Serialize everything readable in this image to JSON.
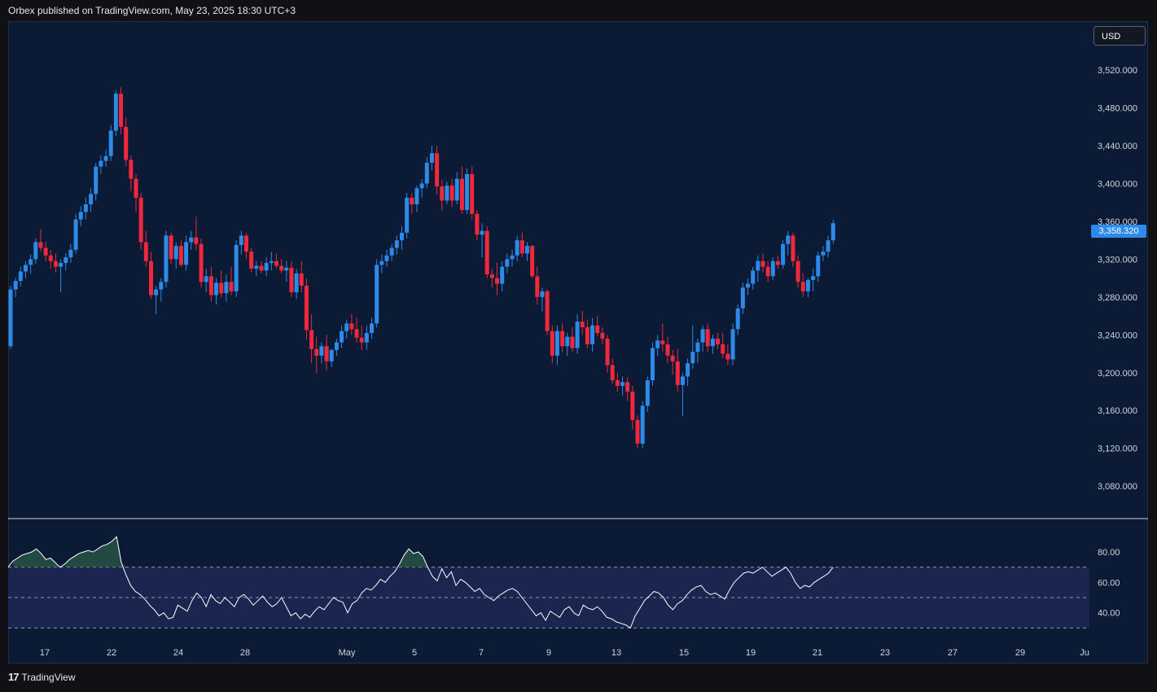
{
  "header": {
    "published": "Orbex published on TradingView.com, May 23, 2025 18:30 UTC+3"
  },
  "currency": "USD",
  "last_price": "3,358.320",
  "footer": {
    "brand": "TradingView",
    "logo": "tradingview-logo-icon"
  },
  "colors": {
    "up": "#2c8ae8",
    "down": "#f0283c",
    "background": "#0b1a35",
    "rsi_band": "#1a2550",
    "rsi_line": "#ffffff"
  },
  "price_axis": {
    "labels": [
      "3,520.000",
      "3,480.000",
      "3,440.000",
      "3,400.000",
      "3,360.000",
      "3,320.000",
      "3,280.000",
      "3,240.000",
      "3,200.000",
      "3,160.000",
      "3,120.000",
      "3,080.000"
    ]
  },
  "rsi_axis": {
    "labels": [
      "80.00",
      "60.00",
      "40.00"
    ]
  },
  "time_axis": {
    "labels": [
      "17",
      "22",
      "24",
      "28",
      "May",
      "5",
      "7",
      "9",
      "13",
      "15",
      "19",
      "21",
      "23",
      "27",
      "29",
      "Ju"
    ]
  },
  "chart_data": {
    "type": "candlestick",
    "ylim": [
      3050,
      3570
    ],
    "candles": [
      [
        3228,
        3292,
        3225,
        3288
      ],
      [
        3288,
        3300,
        3280,
        3297
      ],
      [
        3297,
        3312,
        3291,
        3307
      ],
      [
        3307,
        3318,
        3300,
        3314
      ],
      [
        3314,
        3325,
        3305,
        3320
      ],
      [
        3320,
        3342,
        3315,
        3338
      ],
      [
        3338,
        3352,
        3328,
        3332
      ],
      [
        3332,
        3338,
        3318,
        3324
      ],
      [
        3324,
        3330,
        3310,
        3318
      ],
      [
        3318,
        3326,
        3306,
        3312
      ],
      [
        3312,
        3320,
        3285,
        3316
      ],
      [
        3316,
        3326,
        3308,
        3322
      ],
      [
        3322,
        3336,
        3316,
        3330
      ],
      [
        3330,
        3368,
        3326,
        3362
      ],
      [
        3362,
        3376,
        3355,
        3370
      ],
      [
        3370,
        3385,
        3362,
        3378
      ],
      [
        3378,
        3395,
        3370,
        3389
      ],
      [
        3389,
        3422,
        3382,
        3418
      ],
      [
        3418,
        3430,
        3410,
        3424
      ],
      [
        3424,
        3436,
        3418,
        3429
      ],
      [
        3429,
        3462,
        3424,
        3456
      ],
      [
        3456,
        3498,
        3450,
        3495
      ],
      [
        3495,
        3502,
        3452,
        3460
      ],
      [
        3460,
        3470,
        3418,
        3425
      ],
      [
        3425,
        3430,
        3392,
        3405
      ],
      [
        3405,
        3410,
        3370,
        3385
      ],
      [
        3385,
        3390,
        3330,
        3338
      ],
      [
        3338,
        3350,
        3312,
        3318
      ],
      [
        3318,
        3328,
        3278,
        3282
      ],
      [
        3282,
        3292,
        3262,
        3288
      ],
      [
        3288,
        3300,
        3275,
        3296
      ],
      [
        3296,
        3350,
        3290,
        3345
      ],
      [
        3345,
        3348,
        3315,
        3320
      ],
      [
        3320,
        3338,
        3310,
        3334
      ],
      [
        3334,
        3340,
        3312,
        3314
      ],
      [
        3314,
        3345,
        3308,
        3338
      ],
      [
        3338,
        3350,
        3330,
        3343
      ],
      [
        3343,
        3365,
        3330,
        3336
      ],
      [
        3336,
        3342,
        3290,
        3296
      ],
      [
        3296,
        3310,
        3285,
        3302
      ],
      [
        3302,
        3312,
        3275,
        3282
      ],
      [
        3282,
        3300,
        3272,
        3295
      ],
      [
        3295,
        3308,
        3280,
        3284
      ],
      [
        3284,
        3304,
        3275,
        3296
      ],
      [
        3296,
        3312,
        3282,
        3286
      ],
      [
        3286,
        3340,
        3280,
        3335
      ],
      [
        3335,
        3350,
        3325,
        3345
      ],
      [
        3345,
        3348,
        3320,
        3328
      ],
      [
        3328,
        3332,
        3306,
        3310
      ],
      [
        3310,
        3318,
        3302,
        3313
      ],
      [
        3313,
        3318,
        3305,
        3308
      ],
      [
        3308,
        3322,
        3302,
        3316
      ],
      [
        3316,
        3328,
        3308,
        3318
      ],
      [
        3318,
        3326,
        3310,
        3313
      ],
      [
        3313,
        3320,
        3305,
        3308
      ],
      [
        3308,
        3318,
        3296,
        3311
      ],
      [
        3311,
        3318,
        3280,
        3285
      ],
      [
        3285,
        3310,
        3278,
        3305
      ],
      [
        3305,
        3318,
        3285,
        3292
      ],
      [
        3292,
        3300,
        3235,
        3245
      ],
      [
        3245,
        3262,
        3210,
        3225
      ],
      [
        3225,
        3238,
        3200,
        3218
      ],
      [
        3218,
        3232,
        3210,
        3228
      ],
      [
        3228,
        3240,
        3202,
        3212
      ],
      [
        3212,
        3225,
        3206,
        3224
      ],
      [
        3224,
        3236,
        3218,
        3232
      ],
      [
        3232,
        3250,
        3226,
        3244
      ],
      [
        3244,
        3256,
        3236,
        3252
      ],
      [
        3252,
        3262,
        3240,
        3246
      ],
      [
        3246,
        3258,
        3232,
        3237
      ],
      [
        3237,
        3250,
        3224,
        3232
      ],
      [
        3232,
        3250,
        3224,
        3242
      ],
      [
        3242,
        3258,
        3236,
        3252
      ],
      [
        3252,
        3320,
        3248,
        3314
      ],
      [
        3314,
        3325,
        3305,
        3318
      ],
      [
        3318,
        3330,
        3312,
        3324
      ],
      [
        3324,
        3336,
        3318,
        3332
      ],
      [
        3332,
        3345,
        3325,
        3340
      ],
      [
        3340,
        3355,
        3330,
        3348
      ],
      [
        3348,
        3390,
        3342,
        3385
      ],
      [
        3385,
        3390,
        3368,
        3378
      ],
      [
        3378,
        3398,
        3370,
        3395
      ],
      [
        3395,
        3405,
        3385,
        3400
      ],
      [
        3400,
        3428,
        3395,
        3422
      ],
      [
        3422,
        3440,
        3414,
        3432
      ],
      [
        3432,
        3440,
        3388,
        3397
      ],
      [
        3397,
        3404,
        3372,
        3382
      ],
      [
        3382,
        3402,
        3378,
        3398
      ],
      [
        3398,
        3405,
        3375,
        3382
      ],
      [
        3382,
        3412,
        3378,
        3405
      ],
      [
        3405,
        3418,
        3368,
        3372
      ],
      [
        3372,
        3416,
        3368,
        3410
      ],
      [
        3410,
        3418,
        3362,
        3368
      ],
      [
        3368,
        3372,
        3340,
        3346
      ],
      [
        3346,
        3358,
        3322,
        3350
      ],
      [
        3350,
        3355,
        3300,
        3304
      ],
      [
        3304,
        3310,
        3290,
        3300
      ],
      [
        3300,
        3316,
        3282,
        3294
      ],
      [
        3294,
        3318,
        3286,
        3312
      ],
      [
        3312,
        3326,
        3305,
        3320
      ],
      [
        3320,
        3330,
        3312,
        3324
      ],
      [
        3324,
        3345,
        3318,
        3340
      ],
      [
        3340,
        3348,
        3322,
        3326
      ],
      [
        3326,
        3338,
        3318,
        3334
      ],
      [
        3334,
        3335,
        3300,
        3302
      ],
      [
        3302,
        3312,
        3272,
        3280
      ],
      [
        3280,
        3290,
        3265,
        3286
      ],
      [
        3286,
        3288,
        3240,
        3244
      ],
      [
        3244,
        3250,
        3210,
        3218
      ],
      [
        3218,
        3250,
        3208,
        3244
      ],
      [
        3244,
        3252,
        3222,
        3228
      ],
      [
        3228,
        3242,
        3218,
        3238
      ],
      [
        3238,
        3248,
        3222,
        3226
      ],
      [
        3226,
        3262,
        3220,
        3254
      ],
      [
        3254,
        3265,
        3240,
        3248
      ],
      [
        3248,
        3256,
        3226,
        3230
      ],
      [
        3230,
        3258,
        3222,
        3250
      ],
      [
        3250,
        3260,
        3238,
        3242
      ],
      [
        3242,
        3248,
        3230,
        3236
      ],
      [
        3236,
        3240,
        3200,
        3208
      ],
      [
        3208,
        3215,
        3188,
        3192
      ],
      [
        3192,
        3200,
        3180,
        3186
      ],
      [
        3186,
        3196,
        3176,
        3190
      ],
      [
        3190,
        3195,
        3170,
        3180
      ],
      [
        3180,
        3186,
        3140,
        3150
      ],
      [
        3150,
        3155,
        3120,
        3125
      ],
      [
        3125,
        3170,
        3120,
        3165
      ],
      [
        3165,
        3196,
        3158,
        3192
      ],
      [
        3192,
        3232,
        3186,
        3226
      ],
      [
        3226,
        3240,
        3218,
        3234
      ],
      [
        3234,
        3252,
        3222,
        3230
      ],
      [
        3230,
        3238,
        3210,
        3218
      ],
      [
        3218,
        3224,
        3198,
        3212
      ],
      [
        3212,
        3225,
        3180,
        3187
      ],
      [
        3187,
        3200,
        3154,
        3196
      ],
      [
        3196,
        3215,
        3186,
        3210
      ],
      [
        3210,
        3250,
        3204,
        3222
      ],
      [
        3222,
        3236,
        3210,
        3232
      ],
      [
        3232,
        3250,
        3222,
        3246
      ],
      [
        3246,
        3252,
        3222,
        3228
      ],
      [
        3228,
        3240,
        3220,
        3236
      ],
      [
        3236,
        3242,
        3225,
        3230
      ],
      [
        3230,
        3242,
        3215,
        3220
      ],
      [
        3220,
        3230,
        3208,
        3214
      ],
      [
        3214,
        3252,
        3208,
        3246
      ],
      [
        3246,
        3272,
        3240,
        3268
      ],
      [
        3268,
        3295,
        3262,
        3290
      ],
      [
        3290,
        3300,
        3282,
        3294
      ],
      [
        3294,
        3312,
        3288,
        3308
      ],
      [
        3308,
        3324,
        3296,
        3318
      ],
      [
        3318,
        3326,
        3306,
        3312
      ],
      [
        3312,
        3318,
        3296,
        3302
      ],
      [
        3302,
        3322,
        3298,
        3318
      ],
      [
        3318,
        3324,
        3310,
        3314
      ],
      [
        3314,
        3340,
        3310,
        3336
      ],
      [
        3336,
        3350,
        3324,
        3345
      ],
      [
        3345,
        3348,
        3312,
        3318
      ],
      [
        3318,
        3324,
        3290,
        3296
      ],
      [
        3296,
        3305,
        3280,
        3286
      ],
      [
        3286,
        3300,
        3280,
        3298
      ],
      [
        3298,
        3310,
        3286,
        3302
      ],
      [
        3302,
        3328,
        3296,
        3324
      ],
      [
        3324,
        3334,
        3318,
        3328
      ],
      [
        3328,
        3345,
        3322,
        3340
      ],
      [
        3340,
        3362,
        3336,
        3358
      ]
    ],
    "rsi": {
      "levels": [
        70,
        50,
        30
      ],
      "ylim": [
        20,
        95
      ],
      "values": [
        70,
        74,
        76,
        78,
        79,
        80,
        82,
        79,
        75,
        76,
        73,
        70,
        72,
        75,
        77,
        79,
        80,
        81,
        80,
        82,
        84,
        85,
        87,
        90,
        73,
        65,
        58,
        54,
        52,
        49,
        45,
        42,
        38,
        40,
        36,
        37,
        45,
        43,
        41,
        48,
        53,
        50,
        44,
        52,
        48,
        46,
        50,
        47,
        44,
        50,
        52,
        49,
        45,
        48,
        51,
        47,
        44,
        46,
        50,
        44,
        38,
        40,
        36,
        39,
        37,
        41,
        44,
        42,
        46,
        50,
        48,
        47,
        40,
        46,
        48,
        53,
        56,
        55,
        58,
        62,
        60,
        64,
        67,
        72,
        78,
        82,
        79,
        80,
        77,
        70,
        64,
        61,
        69,
        63,
        67,
        58,
        62,
        60,
        57,
        54,
        56,
        52,
        50,
        48,
        51,
        53,
        55,
        56,
        54,
        50,
        46,
        42,
        38,
        40,
        35,
        41,
        39,
        37,
        42,
        44,
        40,
        38,
        45,
        43,
        42,
        44,
        41,
        37,
        36,
        34,
        33,
        32,
        30,
        38,
        43,
        48,
        51,
        54,
        53,
        50,
        45,
        42,
        46,
        48,
        52,
        55,
        57,
        58,
        54,
        52,
        53,
        51,
        49,
        55,
        60,
        63,
        66,
        67,
        66,
        68,
        70,
        67,
        64,
        66,
        68,
        70,
        66,
        60,
        56,
        58,
        57,
        60,
        62,
        64,
        66,
        70
      ]
    },
    "price_ticks": [
      3520,
      3480,
      3440,
      3400,
      3360,
      3320,
      3280,
      3240,
      3200,
      3160,
      3120,
      3080
    ],
    "rsi_ticks": [
      80,
      60,
      40
    ]
  }
}
